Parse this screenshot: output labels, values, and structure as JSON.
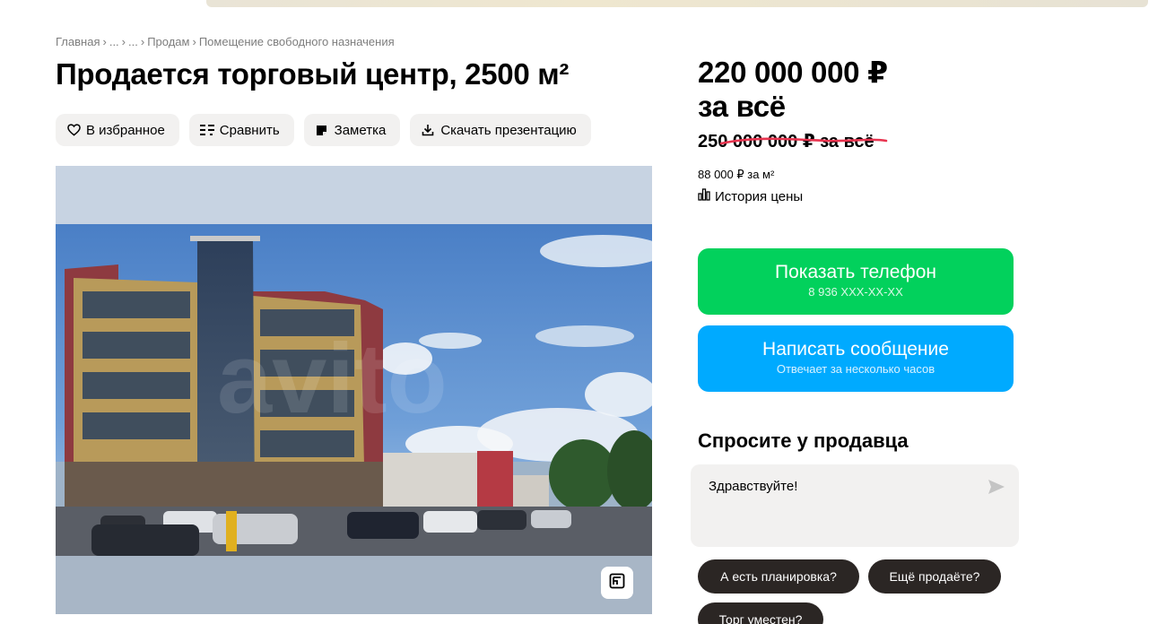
{
  "breadcrumb": {
    "items": [
      "Главная",
      "...",
      "...",
      "Продам",
      "Помещение свободного назначения"
    ],
    "separator": "›"
  },
  "title": "Продается торговый центр, 2500 м²",
  "actions": {
    "favorite": "В избранное",
    "compare": "Сравнить",
    "note": "Заметка",
    "download": "Скачать презентацию"
  },
  "photo": {
    "watermark": "avito"
  },
  "price": {
    "current_line1": "220 000 000 ₽",
    "current_line2": "за всё",
    "old": "250 000 000 ₽ за всё",
    "per_m2": "88 000 ₽ за м²",
    "history_label": "История цены"
  },
  "contact": {
    "phone_label": "Показать телефон",
    "phone_masked": "8 936 XXX-XX-XX",
    "message_label": "Написать сообщение",
    "message_sub": "Отвечает за несколько часов"
  },
  "ask": {
    "title": "Спросите у продавца",
    "input_value": "Здравствуйте!",
    "chips": [
      "А есть планировка?",
      "Ещё продаёте?",
      "Торг уместен?"
    ]
  },
  "colors": {
    "phone_button": "#02d15c",
    "message_button": "#00aaff",
    "chip_bg": "#2b2624",
    "strike_red": "#e8344f"
  },
  "icons": {
    "favorite": "heart-icon",
    "compare": "compare-icon",
    "note": "note-icon",
    "download": "download-icon",
    "history": "bar-chart-icon",
    "send": "send-icon",
    "gallery": "gallery-icon"
  }
}
